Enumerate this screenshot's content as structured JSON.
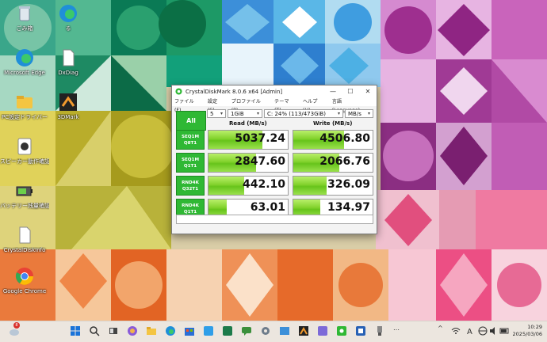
{
  "desktop": {
    "icons": [
      {
        "label": "ごみ箱"
      },
      {
        "label": "る"
      },
      {
        "label": "Microsoft Edge"
      },
      {
        "label": "DxDiag"
      },
      {
        "label": "PC設定ドライバー"
      },
      {
        "label": "3DMark"
      },
      {
        "label": "スピーカー動作確認"
      },
      {
        "label": "バッテリー残量確認"
      },
      {
        "label": "CrystalDiskInfo"
      },
      {
        "label": "Google Chrome"
      }
    ]
  },
  "window": {
    "title": "CrystalDiskMark 8.0.6 x64 [Admin]",
    "controls": {
      "minimize": "—",
      "maximize": "☐",
      "close": "✕"
    },
    "menu": [
      "ファイル(F)",
      "設定(S)",
      "プロファイル(P)",
      "テーマ(T)",
      "ヘルプ(H)",
      "言語(Language)"
    ],
    "all_label": "All",
    "count": "5",
    "size": "1GiB",
    "drive": "C: 24% (113/473GiB)",
    "unit": "MB/s",
    "read_header": "Read (MB/s)",
    "write_header": "Write (MB/s)",
    "tests": [
      {
        "name": "SEQ1M",
        "params": "Q8T1",
        "read": "5037.24",
        "write": "4506.80",
        "read_fill": 0.68,
        "write_fill": 0.64
      },
      {
        "name": "SEQ1M",
        "params": "Q1T1",
        "read": "2847.60",
        "write": "2066.76",
        "read_fill": 0.6,
        "write_fill": 0.58
      },
      {
        "name": "RND4K",
        "params": "Q32T1",
        "read": "442.10",
        "write": "326.09",
        "read_fill": 0.45,
        "write_fill": 0.42
      },
      {
        "name": "RND4K",
        "params": "Q1T1",
        "read": "63.01",
        "write": "134.97",
        "read_fill": 0.23,
        "write_fill": 0.34
      }
    ]
  },
  "taskbar": {
    "notification_count": "8",
    "clock_time": "10:29",
    "clock_date": "2025/03/06",
    "overflow": "…",
    "tray_chevron": "^"
  }
}
